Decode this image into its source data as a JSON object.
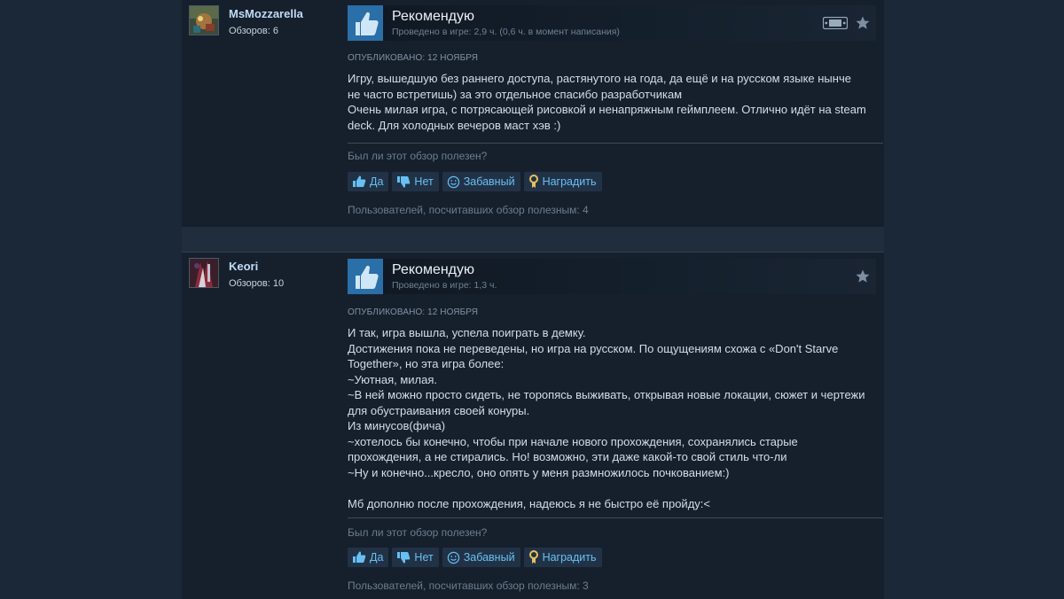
{
  "colors": {
    "page_background": "#1b2838",
    "review_background": "#16202d",
    "thumb_box": "#2a6fa8",
    "link_blue": "#66c0f4",
    "author_name": "#c1dbf4",
    "award_gold": "#e6c15c"
  },
  "reviews": [
    {
      "author": {
        "name": "MsMozzarella",
        "reviews_count": "Обзоров: 6"
      },
      "verdict": "Рекомендую",
      "hours": "Проведено в игре: 2,9 ч. (0,6 ч. в момент написания)",
      "deck_icon": "steam-deck-icon",
      "posted": "ОПУБЛИКОВАНО: 12 НОЯБРЯ",
      "lines": [
        "Игру, вышедшую без раннего доступа, растянутого на года, да ещё и на русском языке нынче",
        "не часто встретишь) за это отдельное спасибо разработчикам",
        "Очень милая игра, с потрясающей рисовкой и ненапряжным геймплеем. Отлично идёт на steam",
        "deck. Для холодных вечеров маст хэв :)"
      ],
      "helpful_question": "Был ли этот обзор полезен?",
      "buttons": {
        "yes": "Да",
        "no": "Нет",
        "funny": "Забавный",
        "award": "Наградить"
      },
      "found_helpful": "Пользователей, посчитавших обзор полезным: 4"
    },
    {
      "author": {
        "name": "Keori",
        "reviews_count": "Обзоров: 10"
      },
      "verdict": "Рекомендую",
      "hours": "Проведено в игре: 1,3 ч.",
      "posted": "ОПУБЛИКОВАНО: 12 НОЯБРЯ",
      "lines": [
        "И так, игра вышла, успела поиграть в демку.",
        "Достижения пока не переведены, но игра на русском. По ощущениям схожа с «Don't Starve",
        "Together», но эта игра более:",
        "~Уютная, милая.",
        "~В ней можно просто сидеть, не торопясь выживать, открывая новые локации, сюжет и чертежи",
        "для обустраивания своей конуры.",
        "Из минусов(фича)",
        "~хотелось бы конечно, чтобы при начале нового прохождения, сохранялись старые",
        "прохождения, а не стирались. Но! возможно, эти даже какой-то свой стиль что-ли",
        "~Ну и конечно...кресло, оно опять у меня размножилось почкованием:)",
        "",
        "Мб дополню после прохождения, надеюсь я не быстро её пройду:<"
      ],
      "helpful_question": "Был ли этот обзор полезен?",
      "buttons": {
        "yes": "Да",
        "no": "Нет",
        "funny": "Забавный",
        "award": "Наградить"
      },
      "found_helpful": "Пользователей, посчитавших обзор полезным: 3"
    }
  ]
}
